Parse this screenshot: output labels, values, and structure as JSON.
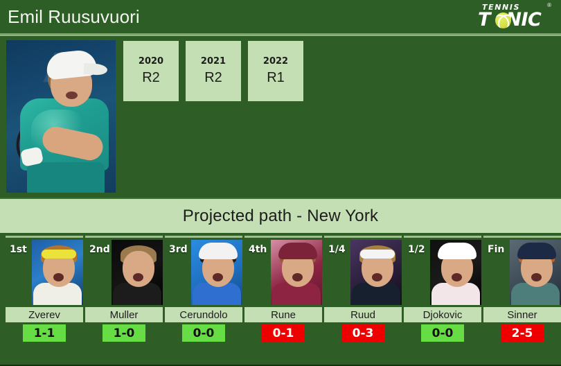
{
  "header": {
    "player_name": "Emil Ruusuvuori",
    "logo": {
      "top_text": "TENNIS",
      "main_text_before": "T",
      "main_text_after": "NIC",
      "registered_mark": "®",
      "ball_icon": "tennis-ball-icon"
    }
  },
  "profile": {
    "photo_alt": "player-photo",
    "photo_bg_text": "A",
    "photo_bg_text2": "N",
    "history": [
      {
        "year": "2020",
        "result": "R2"
      },
      {
        "year": "2021",
        "result": "R2"
      },
      {
        "year": "2022",
        "result": "R1"
      }
    ]
  },
  "projected": {
    "title": "Projected path - New York",
    "cards": [
      {
        "round": "1st",
        "name": "Zverev",
        "score": "1-1",
        "outcome": "win",
        "art": {
          "bg": "linear-gradient(150deg,#1f5fa8 0%,#2c7fc9 45%,#0d3f70 100%)",
          "hair": "#b5732e",
          "band": "#ece23c",
          "torso": "#efefe8",
          "cap": "none"
        }
      },
      {
        "round": "2nd",
        "name": "Muller",
        "score": "1-0",
        "outcome": "win",
        "art": {
          "bg": "linear-gradient(150deg,#0a0a0a 0%,#141414 50%,#000000 100%)",
          "hair": "#9b7a4e",
          "band": "none",
          "torso": "#1c1c1c",
          "cap": "none"
        }
      },
      {
        "round": "3rd",
        "name": "Cerundolo",
        "score": "0-0",
        "outcome": "win",
        "art": {
          "bg": "linear-gradient(150deg,#2b8ce0 0%,#1f6fc0 55%,#134a88 100%)",
          "hair": "#2b1c12",
          "band": "none",
          "torso": "#2f6fd0",
          "cap": "#f2f2f2"
        }
      },
      {
        "round": "4th",
        "name": "Rune",
        "score": "0-1",
        "outcome": "loss",
        "art": {
          "bg": "linear-gradient(150deg,#d58fa5 0%,#8d2442 55%,#5e1730 100%)",
          "hair": "#8f5f36",
          "band": "none",
          "torso": "#8d2442",
          "cap": "#7c2239"
        }
      },
      {
        "round": "1/4",
        "name": "Ruud",
        "score": "0-3",
        "outcome": "loss",
        "art": {
          "bg": "linear-gradient(150deg,#4a3560 0%,#2a1f3a 55%,#120d1c 100%)",
          "hair": "#a9803f",
          "band": "#f4f4f4",
          "torso": "#17202e",
          "cap": "none"
        }
      },
      {
        "round": "1/2",
        "name": "Djokovic",
        "score": "0-0",
        "outcome": "win",
        "art": {
          "bg": "linear-gradient(150deg,#101010 0%,#1a1a1a 50%,#000000 100%)",
          "hair": "#241a12",
          "band": "none",
          "torso": "#f3e6e8",
          "cap": "#ffffff"
        }
      },
      {
        "round": "Fin",
        "name": "Sinner",
        "score": "2-5",
        "outcome": "loss",
        "art": {
          "bg": "linear-gradient(150deg,#5b6a74 0%,#3c4a56 55%,#232c36 100%)",
          "hair": "#c0622c",
          "band": "none",
          "torso": "#4e7e7c",
          "cap": "#1c2a46"
        }
      }
    ]
  },
  "colors": {
    "page_bg": "#2e5e26",
    "panel_light": "#c5dfb4",
    "score_win": "#66dd44",
    "score_loss": "#ee0000",
    "header_text": "#f2f6ef"
  }
}
